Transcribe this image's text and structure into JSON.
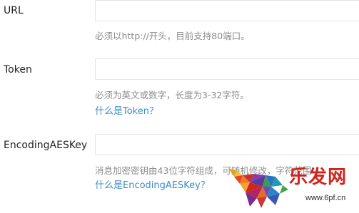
{
  "fields": [
    {
      "label": "URL",
      "value": "",
      "hint": "必须以http://开头，目前支持80端口。"
    },
    {
      "label": "Token",
      "value": "",
      "hint": "必须为英文或数字，长度为3-32字符。",
      "help_link": "什么是Token？"
    },
    {
      "label": "EncodingAESKey",
      "value": "",
      "hint": "消息加密密钥由43位字符组成，可随机修改，字符范围",
      "help_link": "什么是EncodingAESKey？"
    }
  ],
  "watermark": {
    "brand": "乐发网",
    "url": "www.6pf.cn"
  },
  "colors": {
    "link": "#3a8ec9",
    "hint": "#8d8d8d",
    "label": "#222222",
    "input_border": "#e4e4e4",
    "watermark_red": "#d2231d"
  }
}
